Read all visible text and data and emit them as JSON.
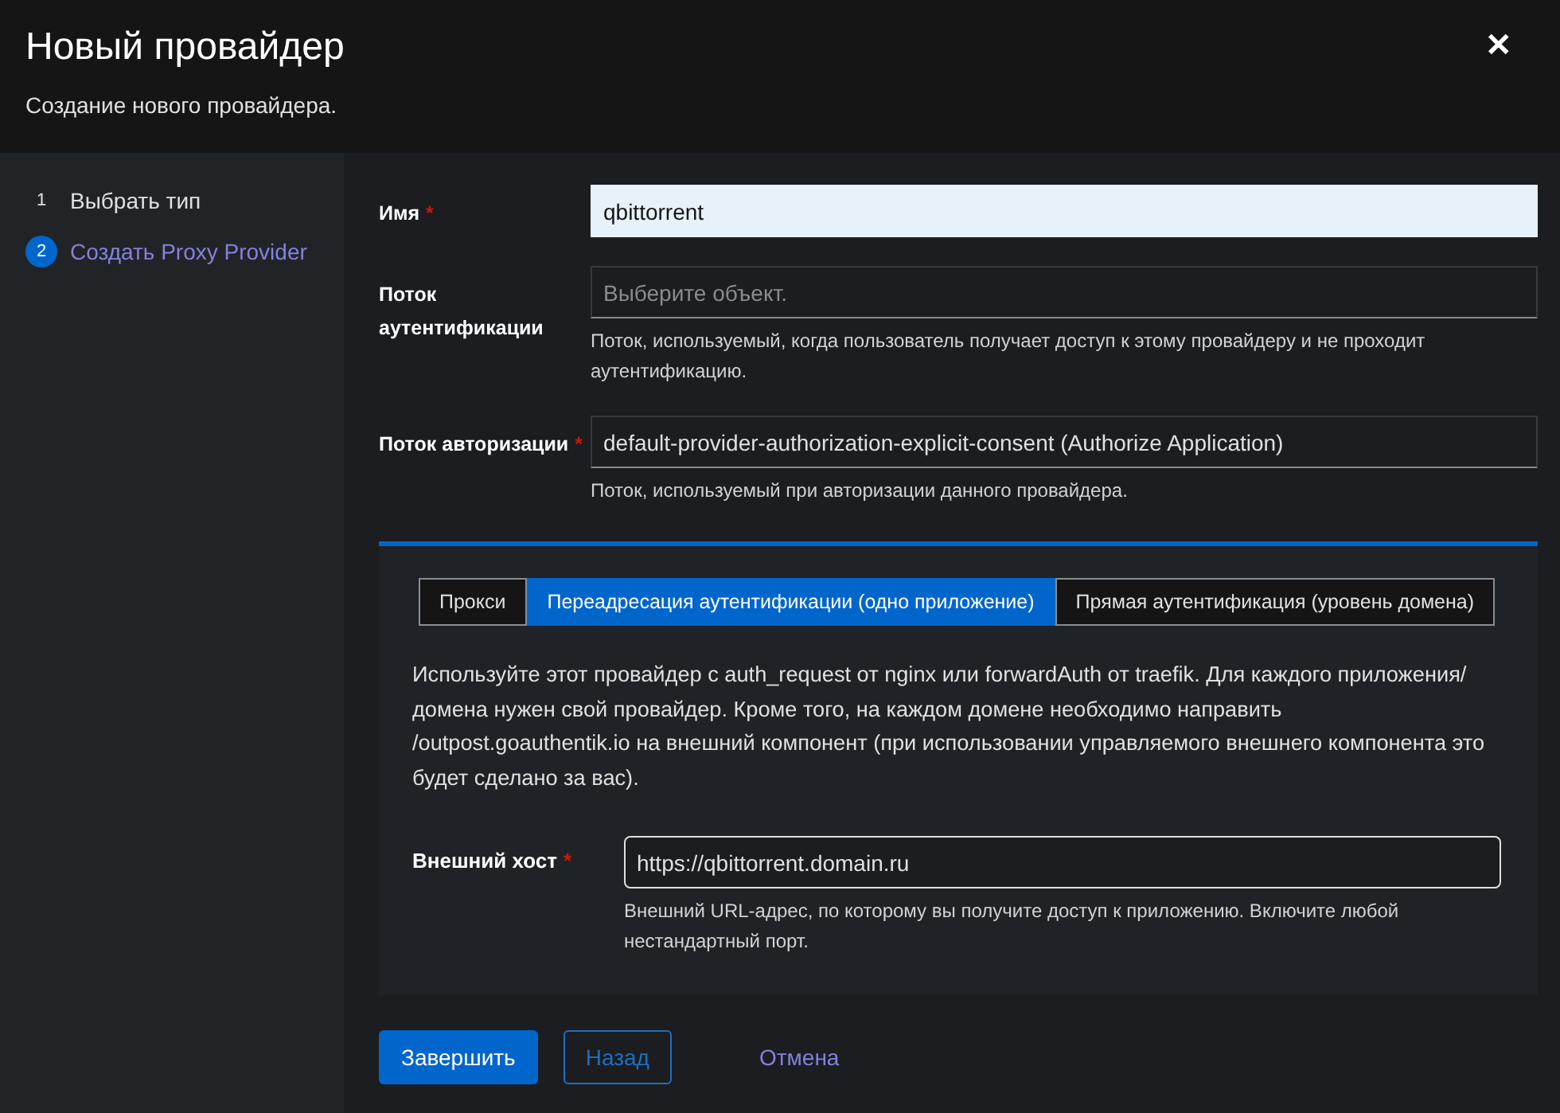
{
  "header": {
    "title": "Новый провайдер",
    "subtitle": "Создание нового провайдера.",
    "close": "✕"
  },
  "steps": [
    {
      "number": "1",
      "label": "Выбрать тип",
      "selected": false
    },
    {
      "number": "2",
      "label": "Создать Proxy Provider",
      "selected": true
    }
  ],
  "fields": [
    {
      "label": "Имя",
      "required_mark": "*",
      "value": "qbittorrent",
      "focused": true
    },
    {
      "label": "Поток аутентификации",
      "placeholder": "Выберите объект.",
      "helper": "Поток, используемый, когда пользователь получает доступ к этому провайдеру и не проходит аутентификацию.",
      "focused": false
    },
    {
      "label": "Поток авторизации",
      "required_mark": "*",
      "value": "default-provider-authorization-explicit-consent (Authorize Application)",
      "helper": "Поток, используемый при авторизации данного провайдера.",
      "focused": false
    }
  ],
  "tabs": [
    {
      "label": "Прокси",
      "selected": false
    },
    {
      "label": "Переадресация аутентификации (одно приложение)",
      "selected": true
    },
    {
      "label": "Прямая аутентификация (уровень домена)",
      "selected": false
    }
  ],
  "description": "Используйте этот провайдер с auth_request от nginx или forwardAuth от traefik. Для каждого приложения/домена нужен свой провайдер. Кроме того, на каждом домене необходимо направить /outpost.goauthentik.io на внешний компонент (при использовании управляемого внешнего компонента это будет сделано за вас).",
  "external_host": {
    "label": "Внешний хост",
    "required_mark": "*",
    "value": "https://qbittorrent.domain.ru",
    "helper": "Внешний URL-адрес, по которому вы получите доступ к приложению. Включите любой нестандартный порт."
  },
  "buttons": [
    {
      "label": "Завершить",
      "kind": "primary"
    },
    {
      "label": "Назад",
      "kind": "secondary"
    },
    {
      "label": "Отмена",
      "kind": "link"
    }
  ]
}
